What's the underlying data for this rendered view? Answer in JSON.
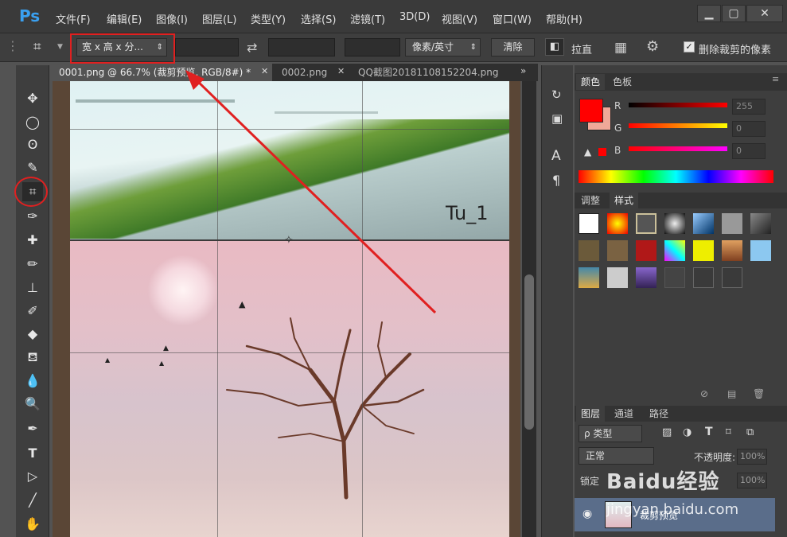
{
  "app": {
    "logo": "Ps"
  },
  "menu": [
    "文件(F)",
    "编辑(E)",
    "图像(I)",
    "图层(L)",
    "类型(Y)",
    "选择(S)",
    "滤镜(T)",
    "3D(D)",
    "视图(V)",
    "窗口(W)",
    "帮助(H)"
  ],
  "window_controls": {
    "minimize": "▁",
    "restore": "▢",
    "close": "✕"
  },
  "options": {
    "ratio_select": "宽 x 高 x 分...",
    "unit_select": "像素/英寸",
    "clear_button": "清除",
    "straighten_label": "拉直",
    "delete_cropped_label": "删除裁剪的像素"
  },
  "tabs": [
    {
      "label": "0001.png @ 66.7% (裁剪预览, RGB/8#) *"
    },
    {
      "label": "0002.png"
    },
    {
      "label": "QQ截图20181108152204.png"
    }
  ],
  "canvas": {
    "overlay_text": "Tu_1"
  },
  "color_panel": {
    "tab_color": "颜色",
    "tab_swatches": "色板",
    "r_label": "R",
    "g_label": "G",
    "b_label": "B",
    "r_value": "255",
    "g_value": "0",
    "b_value": "0",
    "foreground": "#ff0000",
    "background": "#f0a898"
  },
  "styles_panel": {
    "tab_adjust": "调整",
    "tab_styles": "样式"
  },
  "layers_panel": {
    "tab_layers": "图层",
    "tab_channels": "通道",
    "tab_paths": "路径",
    "filter_label": "ρ 类型",
    "blend_mode": "正常",
    "opacity_label": "不透明度:",
    "opacity_value": "100%",
    "lock_label": "锁定",
    "fill_value": "100%",
    "layer_name": "裁剪预览"
  },
  "watermark": {
    "text": "Baidu经验",
    "url": "jingyan.baidu.com"
  },
  "accent_colors": {
    "annotation_red": "#e02020",
    "ps_blue": "#3aa0f0"
  }
}
